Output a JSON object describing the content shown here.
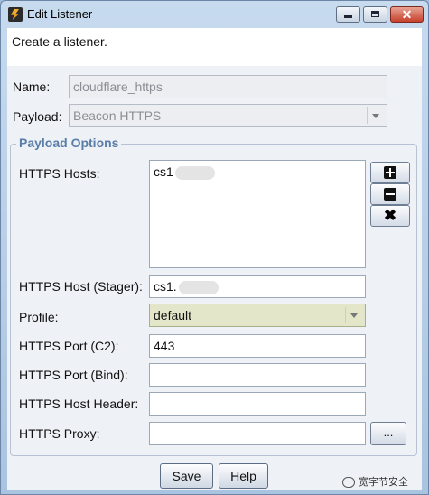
{
  "window": {
    "title": "Edit Listener",
    "minimize_glyph": "",
    "maximize_glyph": "",
    "close_glyph": "✕"
  },
  "description": "Create a listener.",
  "form": {
    "name_label": "Name:",
    "name_value": "cloudflare_https",
    "payload_label": "Payload:",
    "payload_value": "Beacon HTTPS"
  },
  "payload_options": {
    "legend": "Payload Options",
    "hosts_label": "HTTPS Hosts:",
    "hosts_items": [
      "cs1"
    ],
    "host_stager_label": "HTTPS Host (Stager):",
    "host_stager_value": "cs1.",
    "profile_label": "Profile:",
    "profile_value": "default",
    "port_c2_label": "HTTPS Port (C2):",
    "port_c2_value": "443",
    "port_bind_label": "HTTPS Port (Bind):",
    "port_bind_value": "",
    "host_header_label": "HTTPS Host Header:",
    "host_header_value": "",
    "proxy_label": "HTTPS Proxy:",
    "proxy_value": "",
    "ellipsis_label": "...",
    "side_buttons": [
      "add-icon",
      "remove-icon",
      "clear-icon"
    ]
  },
  "buttons": {
    "save": "Save",
    "help": "Help"
  },
  "watermark": "宽字节安全",
  "colors": {
    "title_bar": "#c7daee",
    "legend_text": "#5a7ea8",
    "profile_bg": "#e3e6c8"
  }
}
